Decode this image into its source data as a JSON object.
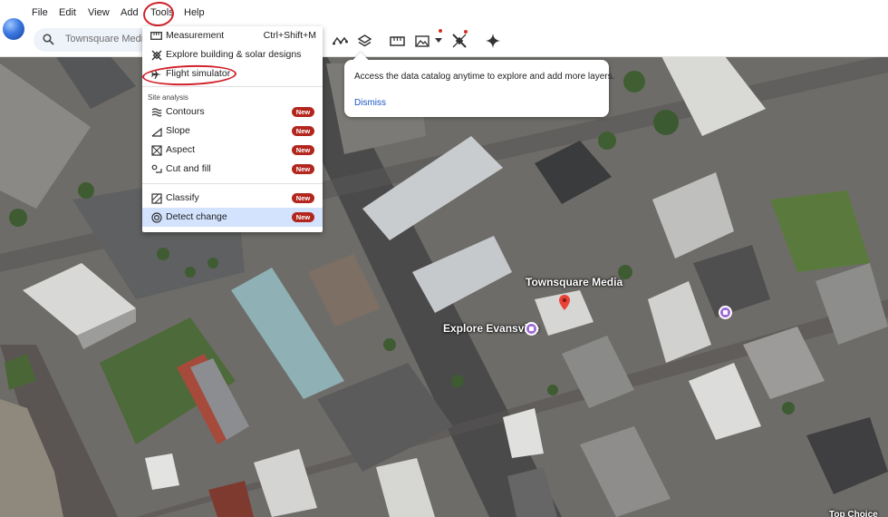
{
  "menubar": {
    "items": [
      "File",
      "Edit",
      "View",
      "Add",
      "Tools",
      "Help"
    ]
  },
  "search": {
    "value": "Townsquare Media"
  },
  "tools_menu": {
    "items": [
      {
        "label": "Measurement",
        "shortcut": "Ctrl+Shift+M",
        "icon": "ruler-icon"
      },
      {
        "label": "Explore building & solar designs",
        "icon": "solar-panel-icon"
      },
      {
        "label": "Flight simulator",
        "icon": "airplane-icon"
      }
    ],
    "section_title": "Site analysis",
    "site_analysis": [
      {
        "label": "Contours",
        "badge": "New",
        "icon": "contours-icon"
      },
      {
        "label": "Slope",
        "badge": "New",
        "icon": "slope-icon"
      },
      {
        "label": "Aspect",
        "badge": "New",
        "icon": "aspect-icon"
      },
      {
        "label": "Cut and fill",
        "badge": "New",
        "icon": "cut-fill-icon"
      }
    ],
    "more": [
      {
        "label": "Classify",
        "badge": "New",
        "icon": "classify-icon"
      },
      {
        "label": "Detect change",
        "badge": "New",
        "icon": "detect-change-icon"
      }
    ]
  },
  "tooltip": {
    "text": "Access the data catalog anytime to explore and add more layers.",
    "dismiss": "Dismiss"
  },
  "map_labels": {
    "townsquare": "Townsquare Media",
    "explore": "Explore Evansville",
    "corner": "Top Choice"
  },
  "colors": {
    "accent": "#1a55c7",
    "badge": "#b3261e",
    "annotation": "#d1202a",
    "active_row": "#d3e3fd"
  }
}
